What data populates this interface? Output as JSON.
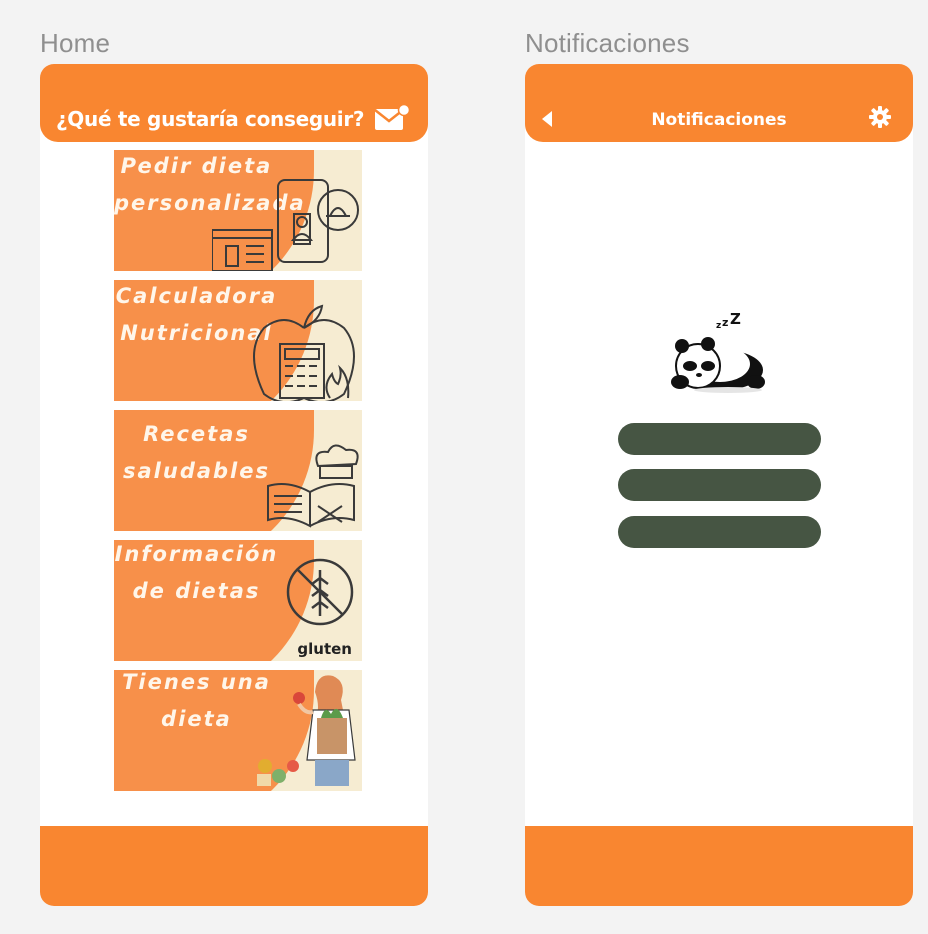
{
  "frames": [
    {
      "label": "Home"
    },
    {
      "label": "Notificaciones"
    }
  ],
  "home": {
    "title": "¿Qué te gustaría conseguir?",
    "mail_icon": "mail-icon",
    "cards": [
      {
        "title": "Pedir dieta personalizada",
        "icon": "phone-order-icon"
      },
      {
        "title": "Calculadora Nutricional",
        "icon": "apple-calculator-icon"
      },
      {
        "title": "Recetas saludables",
        "icon": "recipe-book-icon"
      },
      {
        "title": "Información de dietas",
        "icon": "gluten-free-icon",
        "badge": "gluten"
      },
      {
        "title": "Tienes una dieta",
        "icon": "woman-groceries-icon"
      }
    ]
  },
  "notifications": {
    "title": "Notificaciones",
    "back_icon": "back-arrow-icon",
    "settings_icon": "gear-icon",
    "empty_icon": "sleeping-panda-icon"
  },
  "colors": {
    "accent": "#f98630",
    "card_bg": "#f6ecd2",
    "bar": "#465543"
  }
}
